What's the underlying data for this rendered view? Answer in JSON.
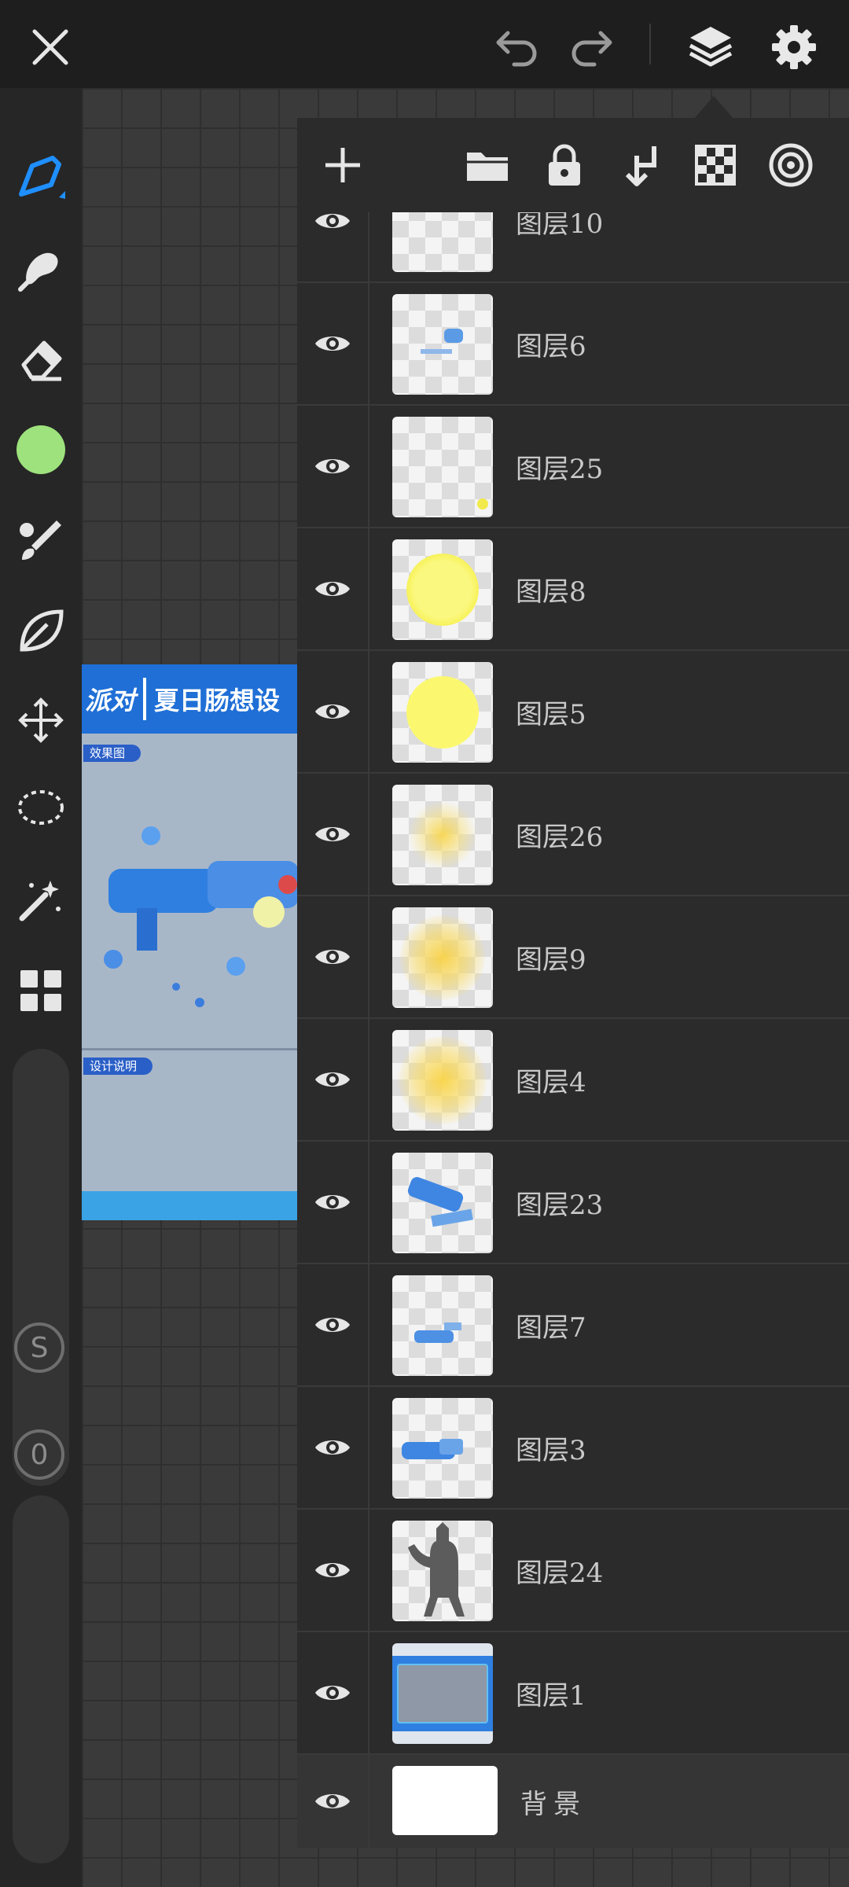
{
  "app": {
    "top_actions": {
      "close_icon": "close-icon",
      "undo_icon": "undo-icon",
      "redo_icon": "redo-icon",
      "layers_icon": "layers-icon",
      "settings_icon": "gear-icon"
    }
  },
  "tools": [
    {
      "name": "pen",
      "icon": "pen-icon"
    },
    {
      "name": "smudge",
      "icon": "smudge-icon"
    },
    {
      "name": "eraser",
      "icon": "eraser-icon"
    },
    {
      "name": "color",
      "icon": "color-swatch",
      "color": "#9de27c"
    },
    {
      "name": "brush",
      "icon": "brush-icon"
    },
    {
      "name": "leaf",
      "icon": "leaf-icon"
    },
    {
      "name": "move",
      "icon": "move-icon"
    },
    {
      "name": "lasso",
      "icon": "lasso-icon"
    },
    {
      "name": "magic-wand",
      "icon": "magic-wand-icon"
    },
    {
      "name": "gallery",
      "icon": "grid-icon"
    }
  ],
  "size_button": "S",
  "opacity_button": "0",
  "artwork": {
    "banner_logo": "派对",
    "banner_title": "夏日肠想设",
    "tag_effect": "效果图",
    "tag_design": "设计说明"
  },
  "layers_panel": {
    "toolbar_icons": [
      "add-icon",
      "folder-icon",
      "lock-icon",
      "merge-down-icon",
      "checkerboard-icon",
      "target-icon"
    ],
    "layers": [
      {
        "name": "图层10"
      },
      {
        "name": "图层6"
      },
      {
        "name": "图层25"
      },
      {
        "name": "图层8"
      },
      {
        "name": "图层5"
      },
      {
        "name": "图层26"
      },
      {
        "name": "图层9"
      },
      {
        "name": "图层4"
      },
      {
        "name": "图层23"
      },
      {
        "name": "图层7"
      },
      {
        "name": "图层3"
      },
      {
        "name": "图层24"
      },
      {
        "name": "图层1"
      },
      {
        "name": "背景"
      }
    ]
  }
}
